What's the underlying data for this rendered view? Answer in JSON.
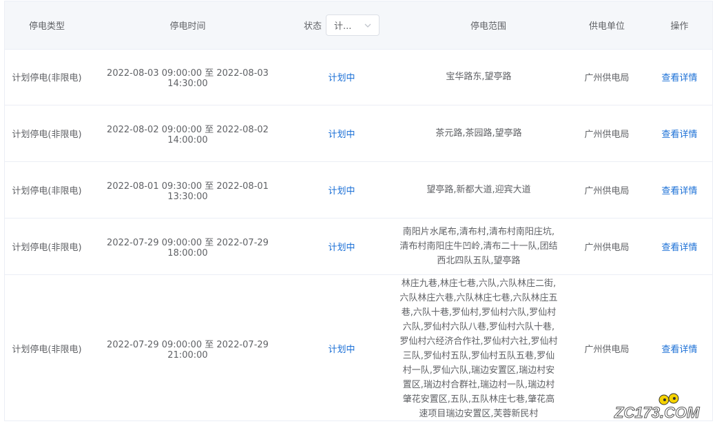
{
  "headers": {
    "type": "停电类型",
    "time": "停电时间",
    "status": "状态",
    "range": "停电范围",
    "unit": "供电单位",
    "op": "操作"
  },
  "status_filter": {
    "selected": "计..."
  },
  "rows": [
    {
      "type": "计划停电(非限电)",
      "time": "2022-08-03 09:00:00 至 2022-08-03 14:30:00",
      "status": "计划中",
      "range": "宝华路东,望亭路",
      "unit": "广州供电局",
      "op": "查看详情"
    },
    {
      "type": "计划停电(非限电)",
      "time": "2022-08-02 09:00:00 至 2022-08-02 14:00:00",
      "status": "计划中",
      "range": "茶元路,茶园路,望亭路",
      "unit": "广州供电局",
      "op": "查看详情"
    },
    {
      "type": "计划停电(非限电)",
      "time": "2022-08-01 09:30:00 至 2022-08-01 13:30:00",
      "status": "计划中",
      "range": "望亭路,新都大道,迎宾大道",
      "unit": "广州供电局",
      "op": "查看详情"
    },
    {
      "type": "计划停电(非限电)",
      "time": "2022-07-29 09:00:00 至 2022-07-29 18:00:00",
      "status": "计划中",
      "range": "南阳片水尾布,清布村,清布村南阳庄坑,清布村南阳庄牛凹岭,清布二十一队,团结西北四队五队,望亭路",
      "unit": "广州供电局",
      "op": "查看详情"
    },
    {
      "type": "计划停电(非限电)",
      "time": "2022-07-29 09:00:00 至 2022-07-29 21:00:00",
      "status": "计划中",
      "range": "林庄九巷,林庄七巷,六队,六队林庄二街,六队林庄六巷,六队林庄七巷,六队林庄五巷,六队十巷,罗仙村,罗仙村六队,罗仙村六队,罗仙村六队八巷,罗仙村六队十巷,罗仙村六经济合作社,罗仙村六社,罗仙村三队,罗仙村五队,罗仙村五队五巷,罗仙村一队,罗仙六队,瑞边安置区,瑞边村安置区,瑞边村合群社,瑞边村一队,瑞边村肇花安置区,五队,五队林庄七巷,肇花高速项目瑞边安置区,芙蓉新民村",
      "unit": "广州供电局",
      "op": "查看详情"
    }
  ],
  "watermark": "ZC173.COM",
  "colors": {
    "link": "#1a6fd6",
    "header_bg": "#f5f7fa",
    "border": "#ebeef5"
  }
}
